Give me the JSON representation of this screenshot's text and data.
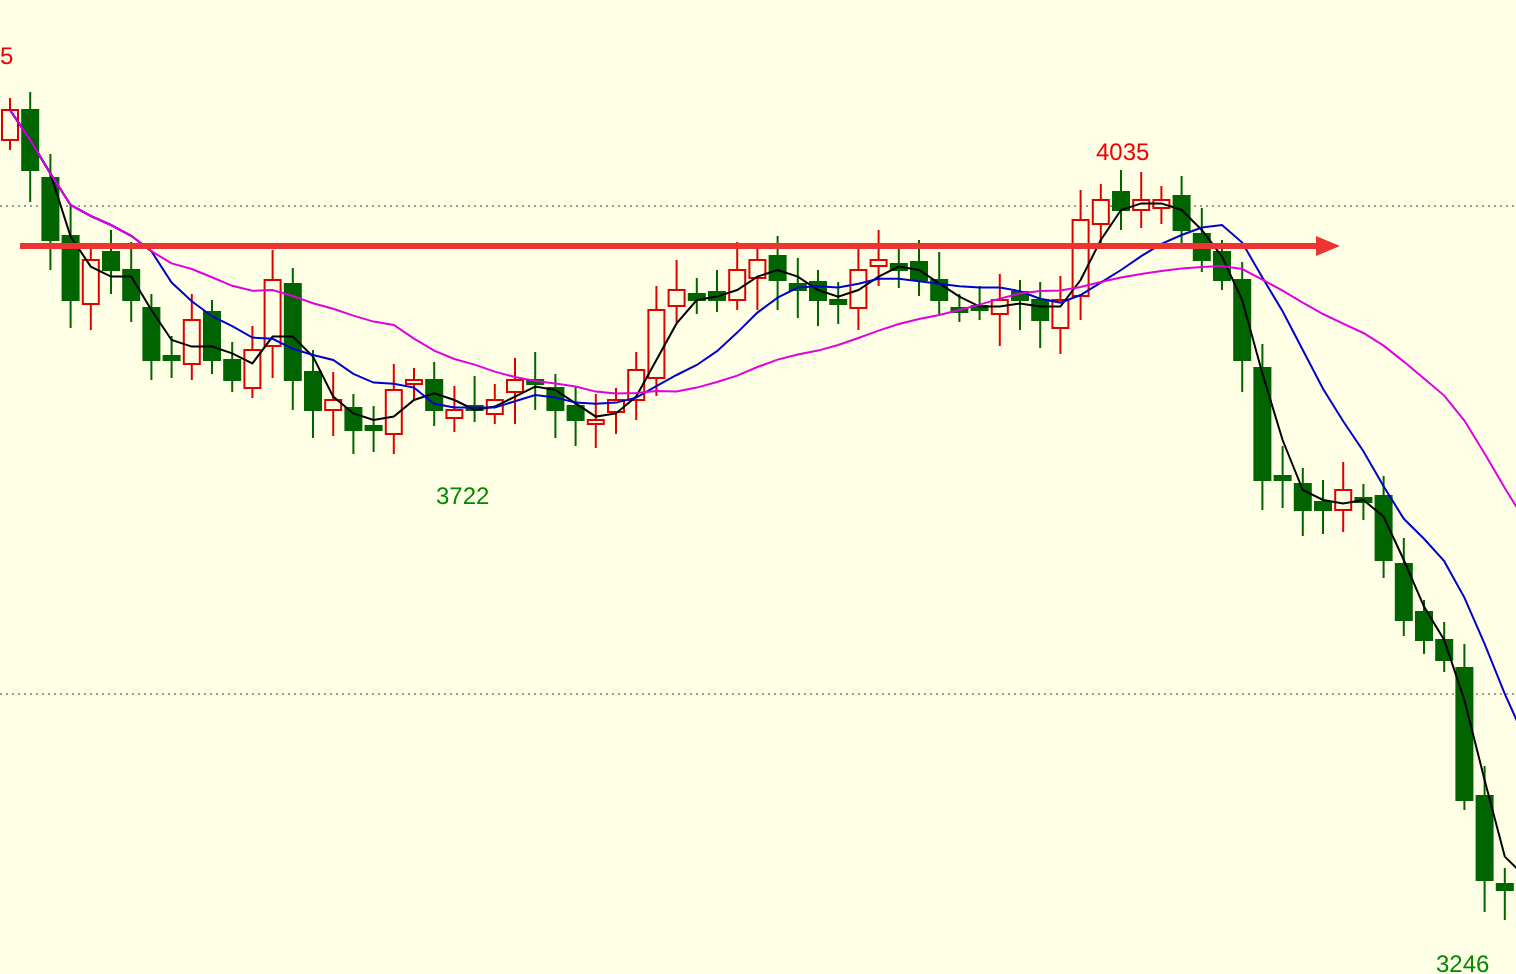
{
  "chart": {
    "price_labels": [
      {
        "text": "5",
        "kind": "high"
      },
      {
        "text": "4035",
        "kind": "high"
      },
      {
        "text": "3722",
        "kind": "low"
      },
      {
        "text": "3246",
        "kind": "low"
      }
    ]
  }
}
